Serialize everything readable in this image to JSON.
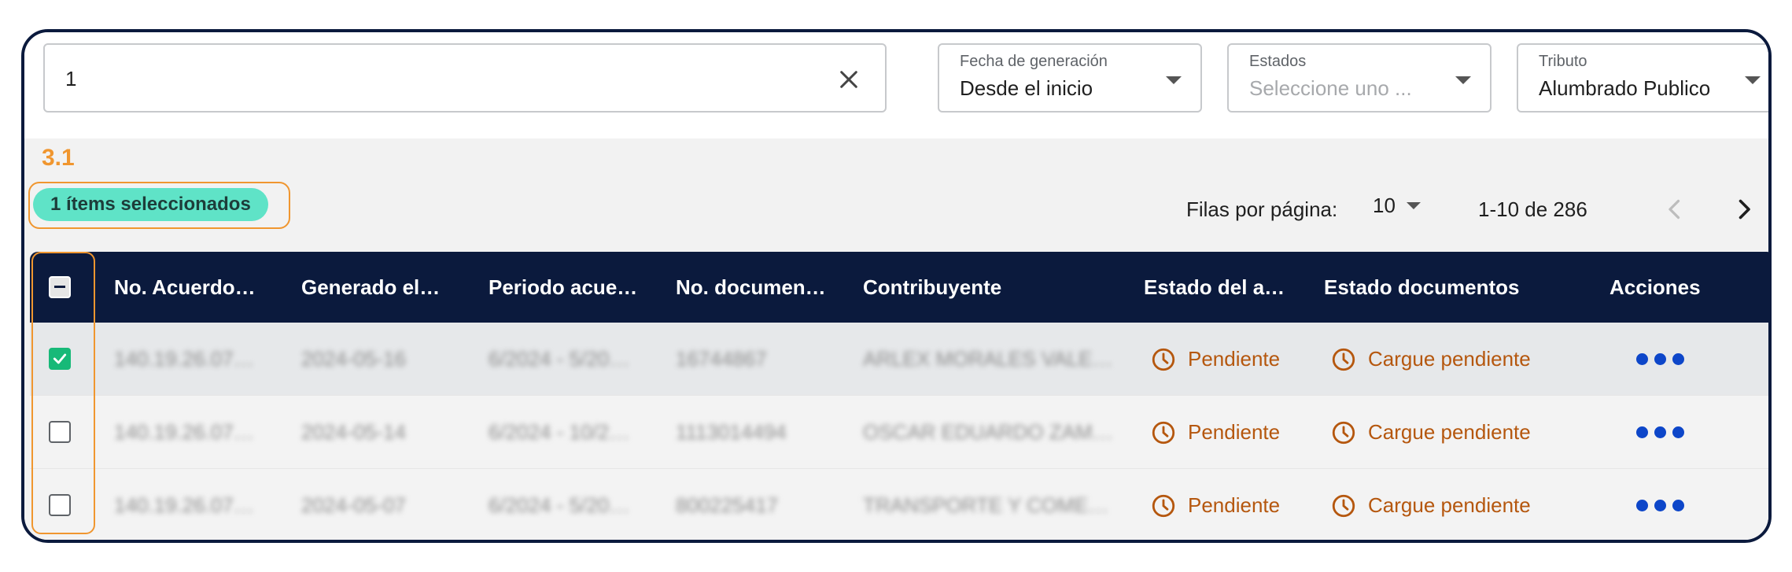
{
  "search": {
    "value": "1"
  },
  "filters": [
    {
      "label": "Fecha de generación",
      "value": "Desde el inicio",
      "placeholder": false
    },
    {
      "label": "Estados",
      "value": "Seleccione uno ...",
      "placeholder": true
    },
    {
      "label": "Tributo",
      "value": "Alumbrado Publico",
      "placeholder": false
    }
  ],
  "step_label": "3.1",
  "selection_chip": "1 ítems seleccionados",
  "pagination": {
    "rows_label": "Filas por página:",
    "rows_value": "10",
    "range": "1-10 de 286"
  },
  "table": {
    "headers": [
      "No. Acuerdo…",
      "Generado el…",
      "Periodo acue…",
      "No. documen…",
      "Contribuyente",
      "Estado del a…",
      "Estado documentos",
      "Acciones"
    ],
    "rows": [
      {
        "checked": true,
        "acuerdo": "140.19.26.07…",
        "generado": "2024-05-16",
        "periodo": "6/2024 - 5/20…",
        "documento": "16744867",
        "contribuyente": "ARLEX MORALES VALE…",
        "estado_acuerdo": "Pendiente",
        "estado_documentos": "Cargue pendiente"
      },
      {
        "checked": false,
        "acuerdo": "140.19.26.07…",
        "generado": "2024-05-14",
        "periodo": "6/2024 - 10/2…",
        "documento": "1113014494",
        "contribuyente": "OSCAR EDUARDO ZAM…",
        "estado_acuerdo": "Pendiente",
        "estado_documentos": "Cargue pendiente"
      },
      {
        "checked": false,
        "acuerdo": "140.19.26.07…",
        "generado": "2024-05-07",
        "periodo": "6/2024 - 5/20…",
        "documento": "800225417",
        "contribuyente": "TRANSPORTE Y COME…",
        "estado_acuerdo": "Pendiente",
        "estado_documentos": "Cargue pendiente"
      }
    ]
  },
  "colors": {
    "header_bg": "#0b1a3d",
    "annotation": "#f0962f",
    "chip": "#5fe3c7",
    "status": "#b5570e",
    "actions": "#0d46c9",
    "checkbox_checked": "#17b978"
  }
}
